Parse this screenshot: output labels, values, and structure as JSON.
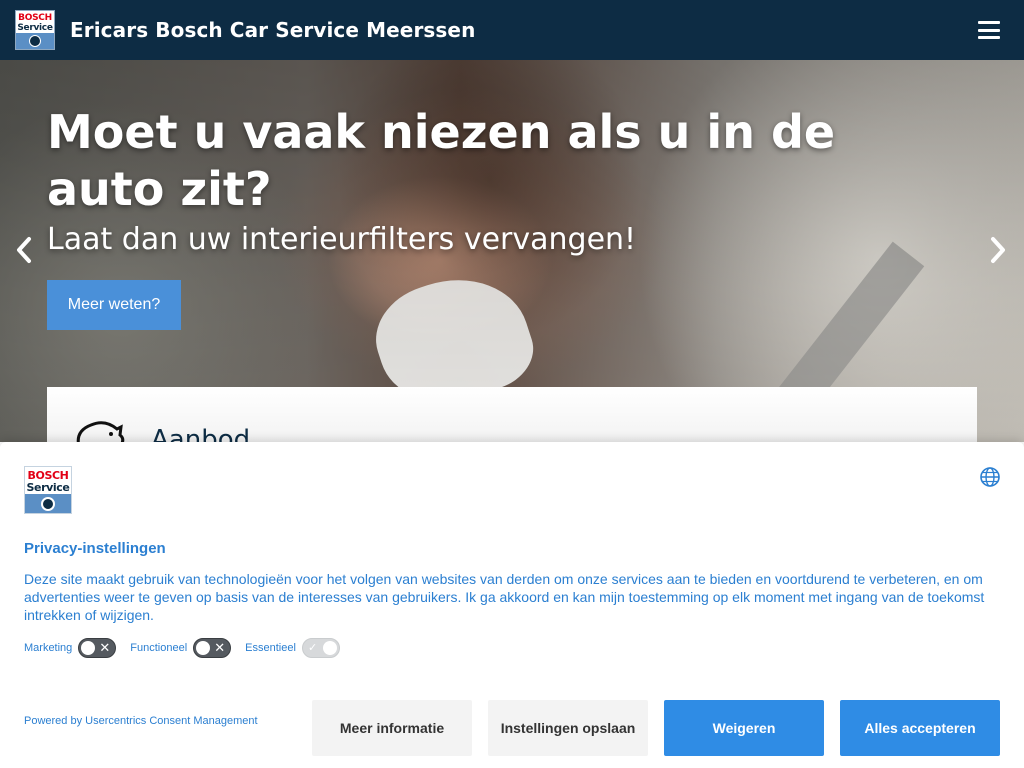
{
  "header": {
    "brand_logo_line1": "BOSCH",
    "brand_logo_line2": "Service",
    "site_title": "Ericars Bosch Car Service Meerssen"
  },
  "hero": {
    "title": "Moet u vaak niezen als u in de auto zit?",
    "subtitle": "Laat dan uw interieurfilters vervangen!",
    "cta_label": "Meer weten?"
  },
  "card": {
    "title": "Aanbod"
  },
  "consent": {
    "logo_line1": "BOSCH",
    "logo_line2": "Service",
    "title": "Privacy-instellingen",
    "text": "Deze site maakt gebruik van technologieën voor het volgen van websites van derden om onze services aan te bieden en voortdurend te verbeteren, en om advertenties weer te geven op basis van de interesses van gebruikers. Ik ga akkoord en kan mijn toestemming op elk moment met ingang van de toekomst intrekken of wijzigen.",
    "toggles": [
      {
        "label": "Marketing",
        "state": "off"
      },
      {
        "label": "Functioneel",
        "state": "off"
      },
      {
        "label": "Essentieel",
        "state": "on"
      }
    ],
    "powered_by": "Powered by Usercentrics Consent Management",
    "buttons": {
      "more_info": "Meer informatie",
      "save_settings": "Instellingen opslaan",
      "deny": "Weigeren",
      "accept_all": "Alles accepteren"
    }
  },
  "colors": {
    "header_bg": "#0d2c44",
    "accent_blue": "#2f8ce5",
    "hero_button": "#4a90d9",
    "consent_text": "#2b7fd1"
  },
  "icons": {
    "menu": "hamburger-icon",
    "prev": "chevron-left-icon",
    "next": "chevron-right-icon",
    "language": "globe-icon"
  }
}
